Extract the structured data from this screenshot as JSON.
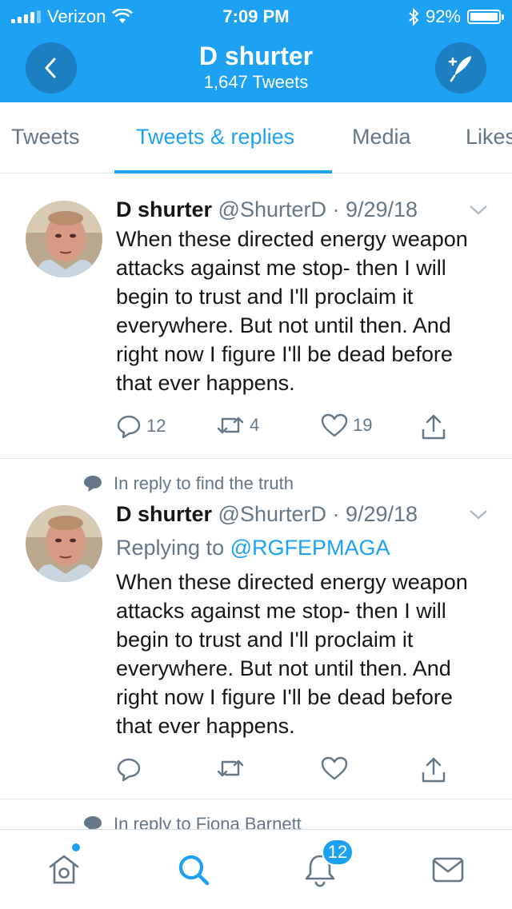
{
  "status_bar": {
    "carrier": "Verizon",
    "time": "7:09 PM",
    "battery": "92%"
  },
  "header": {
    "title": "D shurter",
    "subtitle": "1,647 Tweets"
  },
  "tabs": [
    {
      "label": "Tweets"
    },
    {
      "label": "Tweets & replies"
    },
    {
      "label": "Media"
    },
    {
      "label": "Likes"
    }
  ],
  "active_tab": "Tweets & replies",
  "tweets": [
    {
      "name": "D shurter",
      "handle_date": "@ShurterD · 9/29/18",
      "text": "When these directed energy weapon attacks against me stop- then I will begin to trust and I'll proclaim it everywhere. But not until then. And right now I figure I'll be dead before that ever happens.",
      "replies": "12",
      "retweets": "4",
      "likes": "19"
    },
    {
      "reply_context": "In reply to find the truth",
      "name": "D shurter",
      "handle_date": "@ShurterD · 9/29/18",
      "replying_prefix": "Replying to",
      "replying_handle": "@RGFEPMAGA",
      "text": "When these directed energy weapon attacks against me stop- then I will begin to trust and I'll proclaim it everywhere. But not until then. And right now I figure I'll be dead before that ever happens."
    },
    {
      "reply_context": "In reply to Fiona Barnett"
    }
  ],
  "tab_bar": {
    "items": [
      {
        "icon": "home-icon"
      },
      {
        "icon": "search-icon"
      },
      {
        "icon": "notifications-icon"
      },
      {
        "icon": "messages-icon"
      }
    ],
    "notifications_badge": "12"
  },
  "colors": {
    "accent": "#1da1f2",
    "header_bg": "#1da1f2",
    "text": "#14171a",
    "secondary": "#657786"
  }
}
